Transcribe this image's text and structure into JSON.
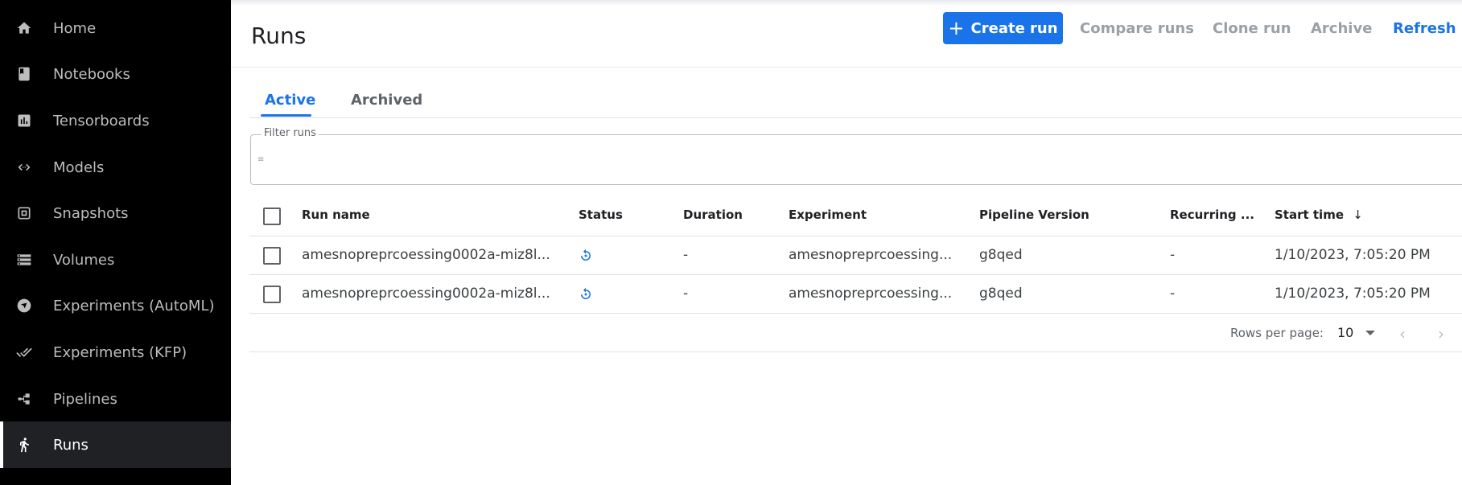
{
  "sidebar": {
    "items": [
      {
        "label": "Home",
        "icon": "home-icon"
      },
      {
        "label": "Notebooks",
        "icon": "notebook-icon"
      },
      {
        "label": "Tensorboards",
        "icon": "bar-chart-icon"
      },
      {
        "label": "Models",
        "icon": "code-arrows-icon"
      },
      {
        "label": "Snapshots",
        "icon": "snapshot-icon"
      },
      {
        "label": "Volumes",
        "icon": "storage-icon"
      },
      {
        "label": "Experiments (AutoML)",
        "icon": "experiment-icon"
      },
      {
        "label": "Experiments (KFP)",
        "icon": "done-all-icon"
      },
      {
        "label": "Pipelines",
        "icon": "pipeline-icon"
      },
      {
        "label": "Runs",
        "icon": "running-icon",
        "active": true
      }
    ]
  },
  "header": {
    "title": "Runs",
    "create_label": "Create run",
    "compare_label": "Compare runs",
    "clone_label": "Clone run",
    "archive_label": "Archive",
    "refresh_label": "Refresh"
  },
  "tabs": [
    {
      "label": "Active",
      "active": true
    },
    {
      "label": "Archived"
    }
  ],
  "filter": {
    "label": "Filter runs",
    "value": ""
  },
  "table": {
    "columns": [
      "Run name",
      "Status",
      "Duration",
      "Experiment",
      "Pipeline Version",
      "Recurring ...",
      "Start time"
    ],
    "sort_icon": "arrow-down-icon",
    "rows": [
      {
        "run_name": "amesnopreprcoessing0002a-miz8l...",
        "status": "running-status-icon",
        "duration": "-",
        "experiment": "amesnopreprcoessing...",
        "pipeline_version": "g8qed",
        "recurring": "-",
        "start_time": "1/10/2023, 7:05:20 PM"
      },
      {
        "run_name": "amesnopreprcoessing0002a-miz8l...",
        "status": "running-status-icon",
        "duration": "-",
        "experiment": "amesnopreprcoessing...",
        "pipeline_version": "g8qed",
        "recurring": "-",
        "start_time": "1/10/2023, 7:05:20 PM"
      }
    ]
  },
  "pagination": {
    "rows_per_page_label": "Rows per page:",
    "rows_per_page": "10"
  },
  "colors": {
    "accent": "#1a73e8",
    "sidebar_bg": "#000000",
    "disabled": "#9aa0a6"
  }
}
